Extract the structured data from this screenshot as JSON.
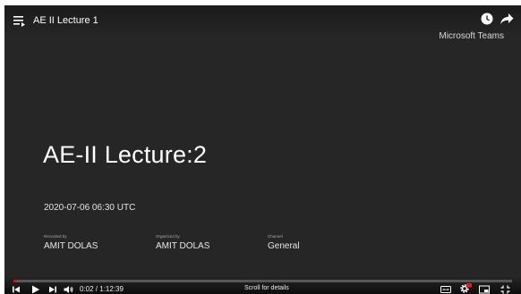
{
  "player": {
    "title": "AE II Lecture 1",
    "brand": "Microsoft Teams",
    "icons": {
      "playlist": "playlist-icon",
      "watch_later": "clock-icon",
      "share": "share-icon"
    }
  },
  "slide": {
    "title": "AE-II Lecture:2",
    "date": "2020-07-06 06:30 UTC",
    "recorded_by_label": "Recorded by",
    "recorded_by": "AMIT DOLAS",
    "organized_by_label": "Organized by",
    "organized_by": "AMIT DOLAS",
    "channel_label": "Channel",
    "channel": "General"
  },
  "controls": {
    "time": "0:02 / 1:12:39",
    "scroll_hint": "Scroll for details",
    "progress_fraction": 0.0005,
    "accent_color": "#ff0000"
  }
}
